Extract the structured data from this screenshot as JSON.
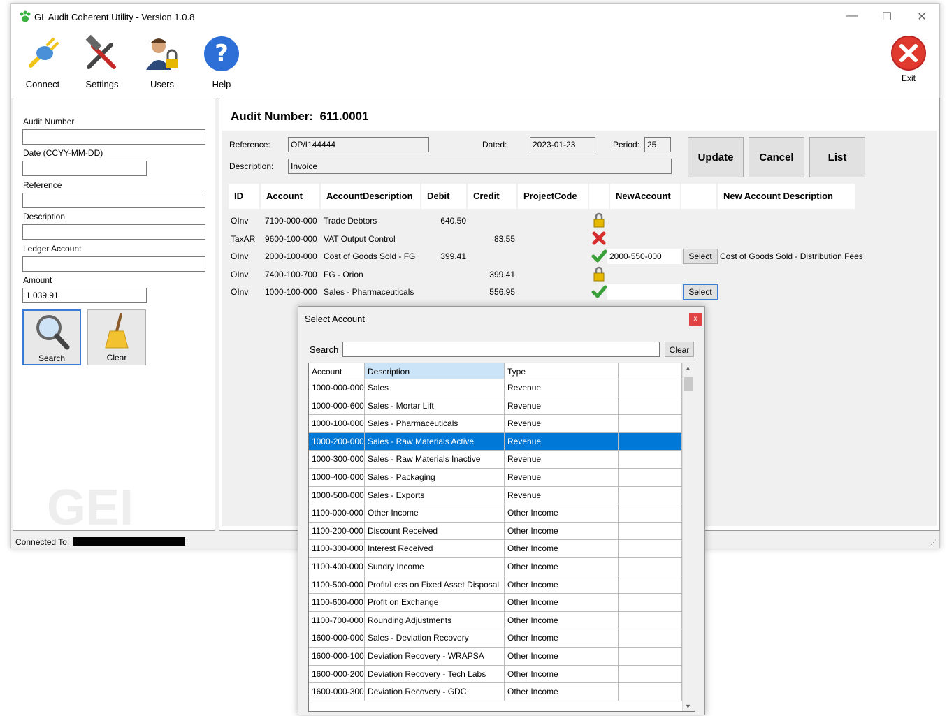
{
  "window": {
    "title": "GL Audit Coherent Utility - Version 1.0.8",
    "minimize": "—",
    "maximize": "☐",
    "close": "✕"
  },
  "toolbar": {
    "connect": "Connect",
    "settings": "Settings",
    "users": "Users",
    "help": "Help",
    "exit": "Exit"
  },
  "left": {
    "audit_number_label": "Audit Number",
    "audit_number_value": "",
    "date_label": "Date (CCYY-MM-DD)",
    "date_value": "",
    "reference_label": "Reference",
    "reference_value": "",
    "description_label": "Description",
    "description_value": "",
    "ledger_label": "Ledger Account",
    "ledger_value": "",
    "amount_label": "Amount",
    "amount_value": "1 039.91",
    "search_button": "Search",
    "clear_button": "Clear",
    "watermark": "GEI"
  },
  "main": {
    "audit_label": "Audit Number:",
    "audit_value": "611.0001",
    "reference_label": "Reference:",
    "reference_value": "OP/I144444",
    "dated_label": "Dated:",
    "dated_value": "2023-01-23",
    "period_label": "Period:",
    "period_value": "25",
    "description_label": "Description:",
    "description_value": "Invoice",
    "update_button": "Update",
    "cancel_button": "Cancel",
    "list_button": "List",
    "headers": {
      "id": "ID",
      "account": "Account",
      "acc_desc_1": "Account",
      "acc_desc_2": "Description",
      "debit": "Debit",
      "credit": "Credit",
      "project_1": "Project",
      "project_2": "Code",
      "new_acc_1": "New",
      "new_acc_2": "Account",
      "new_acc_desc": "New Account Description"
    },
    "rows": [
      {
        "id": "OInv",
        "account": "7100-000-000",
        "description": "Trade Debtors",
        "debit": "640.50",
        "credit": "",
        "status": "lock-icon",
        "new_account": "",
        "new_desc": ""
      },
      {
        "id": "TaxAR",
        "account": "9600-100-000",
        "description": "VAT Output Control",
        "debit": "",
        "credit": "83.55",
        "status": "cross-icon",
        "new_account": "",
        "new_desc": ""
      },
      {
        "id": "OInv",
        "account": "2000-100-000",
        "description": "Cost of Goods Sold - FG",
        "debit": "399.41",
        "credit": "",
        "status": "check-icon",
        "new_account": "2000-550-000",
        "new_desc": "Cost of Goods Sold - Distribution Fees"
      },
      {
        "id": "OInv",
        "account": "7400-100-700",
        "description": "FG - Orion",
        "debit": "",
        "credit": "399.41",
        "status": "lock-icon",
        "new_account": "",
        "new_desc": ""
      },
      {
        "id": "OInv",
        "account": "1000-100-000",
        "description": "Sales - Pharmaceuticals",
        "debit": "",
        "credit": "556.95",
        "status": "check-icon",
        "new_account": "",
        "new_desc": ""
      }
    ],
    "select_label": "Select"
  },
  "statusbar": {
    "connected_label": "Connected To:"
  },
  "dialog": {
    "title": "Select Account",
    "close": "x",
    "search_label": "Search",
    "search_value": "",
    "clear_button": "Clear",
    "columns": [
      "Account",
      "Description",
      "Type"
    ],
    "rows": [
      [
        "1000-000-000",
        "Sales",
        "Revenue"
      ],
      [
        "1000-000-600",
        "Sales - Mortar Lift",
        "Revenue"
      ],
      [
        "1000-100-000",
        "Sales - Pharmaceuticals",
        "Revenue"
      ],
      [
        "1000-200-000",
        "Sales - Raw Materials Active",
        "Revenue"
      ],
      [
        "1000-300-000",
        "Sales - Raw Materials Inactive",
        "Revenue"
      ],
      [
        "1000-400-000",
        "Sales - Packaging",
        "Revenue"
      ],
      [
        "1000-500-000",
        "Sales - Exports",
        "Revenue"
      ],
      [
        "1100-000-000",
        "Other Income",
        "Other Income"
      ],
      [
        "1100-200-000",
        "Discount Received",
        "Other Income"
      ],
      [
        "1100-300-000",
        "Interest Received",
        "Other Income"
      ],
      [
        "1100-400-000",
        "Sundry Income",
        "Other Income"
      ],
      [
        "1100-500-000",
        "Profit/Loss on Fixed Asset Disposal",
        "Other Income"
      ],
      [
        "1100-600-000",
        "Profit on Exchange",
        "Other Income"
      ],
      [
        "1100-700-000",
        "Rounding Adjustments",
        "Other Income"
      ],
      [
        "1600-000-000",
        "Sales - Deviation Recovery",
        "Other Income"
      ],
      [
        "1600-000-100",
        "Deviation Recovery - WRAPSA",
        "Other Income"
      ],
      [
        "1600-000-200",
        "Deviation Recovery - Tech Labs",
        "Other Income"
      ],
      [
        "1600-000-300",
        "Deviation Recovery - GDC",
        "Other Income"
      ]
    ],
    "selected_index": 3
  },
  "colors": {
    "selection": "#0078d7",
    "exit_red": "#e03a2f",
    "help_blue": "#2d6fd6"
  }
}
